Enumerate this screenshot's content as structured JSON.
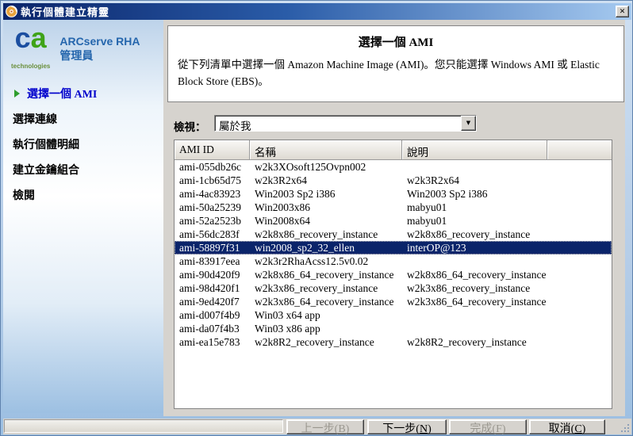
{
  "window": {
    "title": "執行個體建立精靈"
  },
  "icons": {
    "close": "✕",
    "dropdown_arrow": "▼"
  },
  "sidebar": {
    "logo": {
      "c": "c",
      "a": "a",
      "sub": "technologies"
    },
    "product_line1": "ARCserve RHA",
    "product_line2": "管理員",
    "steps": [
      {
        "label": "選擇一個 AMI",
        "active": true
      },
      {
        "label": "選擇連線",
        "active": false
      },
      {
        "label": "執行個體明細",
        "active": false
      },
      {
        "label": "建立金鑰組合",
        "active": false
      },
      {
        "label": "檢閱",
        "active": false
      }
    ]
  },
  "header": {
    "title": "選擇一個 AMI",
    "description": "從下列清單中選擇一個 Amazon Machine Image (AMI)。您只能選擇 Windows AMI 或 Elastic Block Store (EBS)。"
  },
  "view": {
    "label": "檢視：",
    "selected": "屬於我"
  },
  "table": {
    "columns": [
      "AMI ID",
      "名稱",
      "說明",
      ""
    ],
    "rows": [
      {
        "id": "ami-055db26c",
        "name": "w2k3XOsoft125Ovpn002",
        "desc": "",
        "selected": false
      },
      {
        "id": "ami-1cb65d75",
        "name": "w2k3R2x64",
        "desc": "w2k3R2x64",
        "selected": false
      },
      {
        "id": "ami-4ac83923",
        "name": "Win2003 Sp2 i386",
        "desc": "Win2003 Sp2 i386",
        "selected": false
      },
      {
        "id": "ami-50a25239",
        "name": "Win2003x86",
        "desc": "mabyu01",
        "selected": false
      },
      {
        "id": "ami-52a2523b",
        "name": "Win2008x64",
        "desc": "mabyu01",
        "selected": false
      },
      {
        "id": "ami-56dc283f",
        "name": "w2k8x86_recovery_instance",
        "desc": "w2k8x86_recovery_instance",
        "selected": false
      },
      {
        "id": "ami-58897f31",
        "name": "win2008_sp2_32_ellen",
        "desc": "interOP@123",
        "selected": true
      },
      {
        "id": "ami-83917eea",
        "name": "w2k3r2RhaAcss12.5v0.02",
        "desc": "",
        "selected": false
      },
      {
        "id": "ami-90d420f9",
        "name": "w2k8x86_64_recovery_instance",
        "desc": "w2k8x86_64_recovery_instance",
        "selected": false
      },
      {
        "id": "ami-98d420f1",
        "name": "w2k3x86_recovery_instance",
        "desc": "w2k3x86_recovery_instance",
        "selected": false
      },
      {
        "id": "ami-9ed420f7",
        "name": "w2k3x86_64_recovery_instance",
        "desc": "w2k3x86_64_recovery_instance",
        "selected": false
      },
      {
        "id": "ami-d007f4b9",
        "name": "Win03 x64 app",
        "desc": "",
        "selected": false
      },
      {
        "id": "ami-da07f4b3",
        "name": "Win03 x86 app",
        "desc": "",
        "selected": false
      },
      {
        "id": "ami-ea15e783",
        "name": "w2k8R2_recovery_instance",
        "desc": "w2k8R2_recovery_instance",
        "selected": false
      }
    ]
  },
  "buttons": {
    "back": {
      "text": "上一步",
      "mnemonic": "B",
      "enabled": false
    },
    "next": {
      "text": "下一步",
      "mnemonic": "N",
      "enabled": true
    },
    "finish": {
      "text": "完成",
      "mnemonic": "F",
      "enabled": false
    },
    "cancel": {
      "text": "取消",
      "mnemonic": "C",
      "enabled": true
    }
  },
  "colors": {
    "titlebar_start": "#0a246a",
    "titlebar_end": "#a6caf0",
    "selection": "#0a246a",
    "content_bg": "#d6d3ce",
    "accent_blue": "#2566ad",
    "step_active_blue": "#0000cc",
    "arrow_green": "#2e9e2e"
  }
}
